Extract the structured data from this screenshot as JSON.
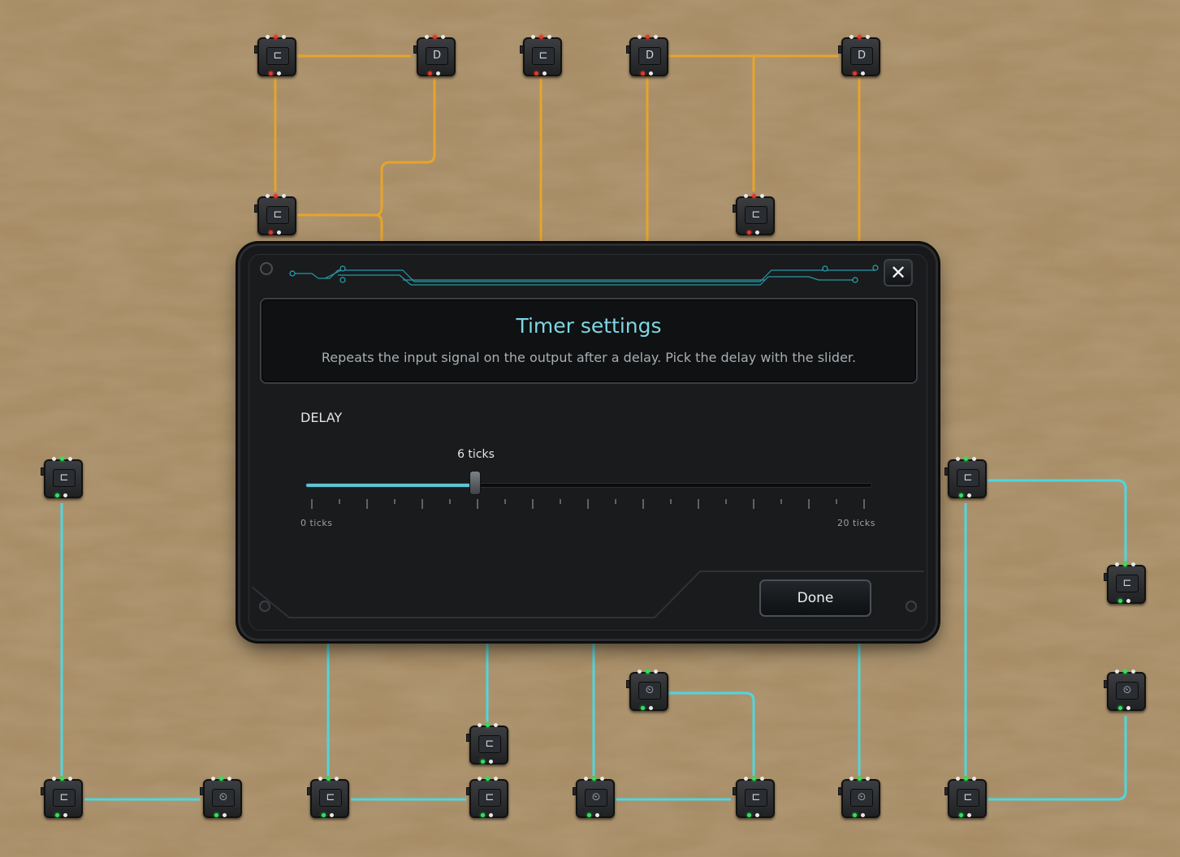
{
  "dialog": {
    "title": "Timer settings",
    "subtitle": "Repeats the input signal on the output after a delay. Pick the delay with the slider.",
    "close_icon": "close-icon",
    "done_label": "Done"
  },
  "delay": {
    "label": "DELAY",
    "value": 6,
    "value_label": "6 ticks",
    "min": 0,
    "max": 20,
    "min_label": "0 ticks",
    "max_label": "20 ticks"
  },
  "colors": {
    "background": "#a58a62",
    "wire_orange": "#e7a42a",
    "wire_cyan": "#4fd6df",
    "accent": "#7fd6e4",
    "dialog": "#17191b"
  },
  "nodes": [
    {
      "type": "splitter",
      "icon": "splitter-icon"
    },
    {
      "type": "and-gate",
      "icon": "and-gate-icon"
    },
    {
      "type": "splitter",
      "icon": "splitter-icon"
    },
    {
      "type": "and-gate",
      "icon": "and-gate-icon"
    },
    {
      "type": "and-gate",
      "icon": "and-gate-icon"
    },
    {
      "type": "splitter",
      "icon": "splitter-icon"
    },
    {
      "type": "splitter",
      "icon": "splitter-icon"
    },
    {
      "type": "splitter",
      "icon": "splitter-icon"
    },
    {
      "type": "splitter",
      "icon": "splitter-icon"
    },
    {
      "type": "splitter",
      "icon": "splitter-icon"
    },
    {
      "type": "timer",
      "icon": "timer-icon"
    },
    {
      "type": "timer",
      "icon": "timer-icon"
    },
    {
      "type": "splitter",
      "icon": "splitter-icon"
    },
    {
      "type": "splitter",
      "icon": "splitter-icon"
    },
    {
      "type": "timer",
      "icon": "timer-icon"
    },
    {
      "type": "splitter",
      "icon": "splitter-icon"
    },
    {
      "type": "splitter",
      "icon": "splitter-icon"
    },
    {
      "type": "timer",
      "icon": "timer-icon"
    },
    {
      "type": "splitter",
      "icon": "splitter-icon"
    },
    {
      "type": "timer",
      "icon": "timer-icon"
    },
    {
      "type": "splitter",
      "icon": "splitter-icon"
    },
    {
      "type": "timer",
      "icon": "timer-icon"
    }
  ]
}
